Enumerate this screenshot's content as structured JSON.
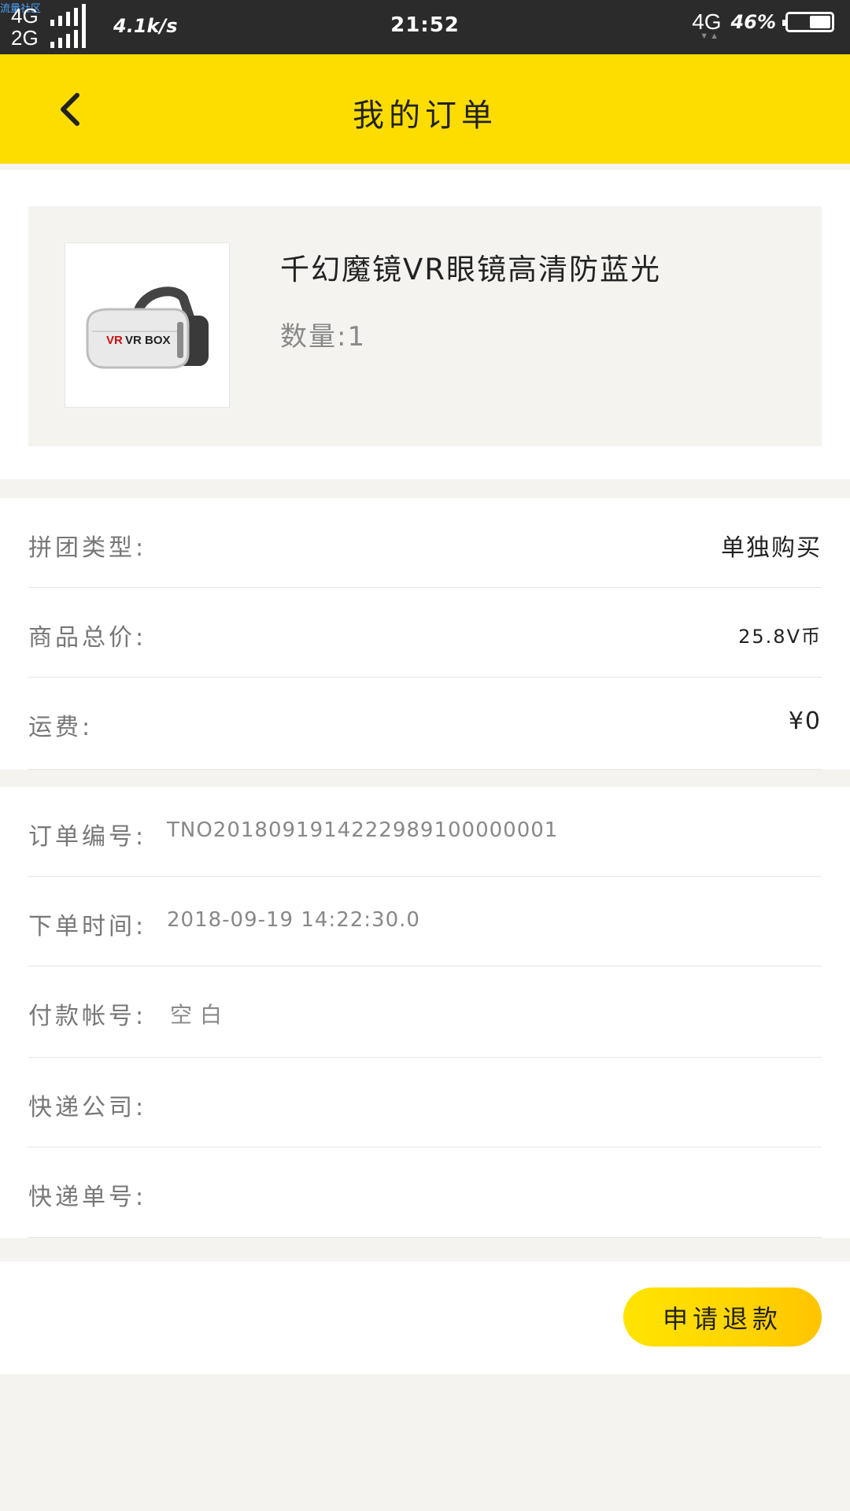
{
  "status_bar": {
    "watermark": "流量社区",
    "net1": "4G",
    "net2": "2G",
    "speed": "4.1k/s",
    "time": "21:52",
    "network": "4G",
    "battery": "46%"
  },
  "header": {
    "title": "我的订单"
  },
  "product": {
    "name": "千幻魔镜VR眼镜高清防蓝光",
    "quantity": "数量:1",
    "image_label": "VR BOX"
  },
  "order_summary": [
    {
      "label": "拼团类型:",
      "value": "单独购买"
    },
    {
      "label": "商品总价:",
      "value": "25.8V币"
    },
    {
      "label": "运费:",
      "value": "¥0"
    }
  ],
  "order_details": [
    {
      "label": "订单编号:",
      "value": "TNO2018091914222989100000001"
    },
    {
      "label": "下单时间:",
      "value": "2018-09-19 14:22:30.0"
    },
    {
      "label": "付款帐号:",
      "value": "空白"
    },
    {
      "label": "快递公司:",
      "value": ""
    },
    {
      "label": "快递单号:",
      "value": ""
    }
  ],
  "footer": {
    "refund_button": "申请退款"
  },
  "colors": {
    "header_bg": "#fddd00",
    "button_gradient_start": "#ffe400",
    "button_gradient_end": "#ffc400",
    "page_bg": "#f5f3ef"
  }
}
